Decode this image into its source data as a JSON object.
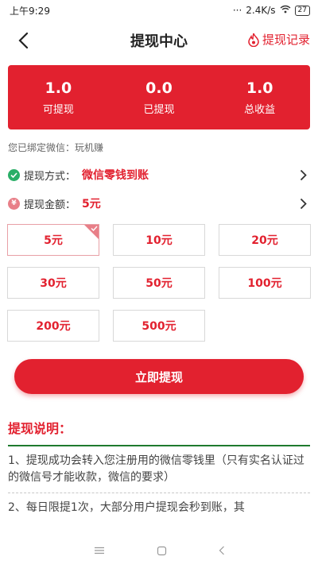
{
  "status_bar": {
    "time": "上午9:29",
    "speed": "2.4K/s",
    "battery": "27"
  },
  "header": {
    "title": "提现中心",
    "record_label": "提现记录"
  },
  "summary": [
    {
      "value": "1.0",
      "label": "可提现"
    },
    {
      "value": "0.0",
      "label": "已提现"
    },
    {
      "value": "1.0",
      "label": "总收益"
    }
  ],
  "bind_info": "您已绑定微信：玩机赚",
  "method": {
    "label": "提现方式：",
    "value": "微信零钱到账"
  },
  "amount": {
    "label": "提现金额：",
    "value": "5元"
  },
  "options": [
    "5元",
    "10元",
    "20元",
    "30元",
    "50元",
    "100元",
    "200元",
    "500元"
  ],
  "selected_option": "5元",
  "withdraw_button": "立即提现",
  "explain": {
    "title": "提现说明：",
    "items": [
      "1、提现成功会转入您注册用的微信零钱里（只有实名认证过的微信号才能收款，微信的要求）",
      "2、每日限提1次，大部分用户提现会秒到账，其"
    ]
  },
  "colors": {
    "accent": "#e2212f",
    "wechat_green": "#2aae67",
    "divider_green": "#1e7a2e"
  }
}
